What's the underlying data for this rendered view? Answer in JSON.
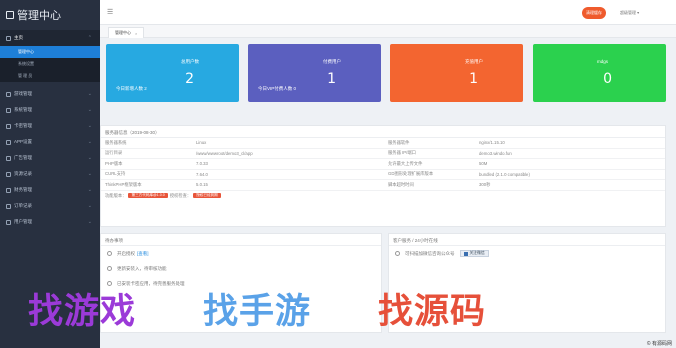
{
  "app": {
    "logo_text": "管理中心"
  },
  "sidebar": {
    "items": [
      {
        "label": "主页",
        "icon": "home-icon",
        "expanded": true
      },
      {
        "label": "游戏管理",
        "icon": "gamepad-icon"
      },
      {
        "label": "系统管理",
        "icon": "settings-icon"
      },
      {
        "label": "卡密管理",
        "icon": "key-icon"
      },
      {
        "label": "APP设置",
        "icon": "app-icon"
      },
      {
        "label": "广告管理",
        "icon": "ad-icon"
      },
      {
        "label": "资源记录",
        "icon": "record-icon"
      },
      {
        "label": "财务管理",
        "icon": "finance-icon"
      },
      {
        "label": "订单记录",
        "icon": "order-icon"
      },
      {
        "label": "用户管理",
        "icon": "user-icon"
      }
    ],
    "subitems": [
      {
        "label": "管理中心",
        "active": true
      },
      {
        "label": "系统设置",
        "active": false
      },
      {
        "label": "管 理 员",
        "active": false
      }
    ]
  },
  "topbar": {
    "menu_icon": "☰",
    "action_button": "清理缓存",
    "user_menu": "超级管理 ▾"
  },
  "tabs": [
    {
      "label": "管理中心"
    }
  ],
  "stats": [
    {
      "label": "总用户数",
      "value": "2",
      "sub": "今日新增人数 2",
      "color": "#27a9e1"
    },
    {
      "label": "付费用户",
      "value": "1",
      "sub": "今日VIP付费人数 0",
      "color": "#5b5fbf"
    },
    {
      "label": "充值用户",
      "value": "1",
      "sub": "",
      "color": "#f36530"
    },
    {
      "label": "mdgs",
      "value": "0",
      "sub": "",
      "color": "#2bd14e"
    }
  ],
  "system_info": {
    "title": "服务器信息（2019-08-30）",
    "rows": [
      {
        "k1": "服务器系统",
        "v1": "Linux",
        "k2": "服务器软件",
        "v2": "nginx/1.15.10"
      },
      {
        "k1": "运行目录",
        "v1": "/www/wwwroot/demo3_cl/app",
        "k2": "服务器 IP/端口",
        "v2": "demo3.windo.fun"
      },
      {
        "k1": "PHP版本",
        "v1": "7.0.33",
        "k2": "允许最大上传文件",
        "v2": "50M"
      },
      {
        "k1": "CURL支持",
        "v1": "7.64.0",
        "k2": "GD图形处理扩展库版本",
        "v2": "bundled (2.1.0 compatible)"
      },
      {
        "k1": "ThinkPHP框架版本",
        "v1": "5.0.15",
        "k2": "脚本超时时间",
        "v2": "300秒"
      }
    ],
    "footer_label": "功能版本：",
    "footer_tag1": "第三方代码库@1.0.0",
    "footer_mid": "授权检查：",
    "footer_tag2": "授权已经到期"
  },
  "todo": {
    "title": "待办事项",
    "items": [
      {
        "text": "开启授权",
        "link": "[查看]"
      },
      {
        "text": "更新安装入，待审核功能",
        "link": ""
      },
      {
        "text": "已安装卡密应用，待完善服务处理",
        "link": ""
      }
    ]
  },
  "weixin": {
    "title": "客户服务 / 24小时在线",
    "items": [
      {
        "text": "可扫描加微信咨询公众号",
        "badge": "关注微信"
      }
    ]
  },
  "watermark": {
    "part1": "找游戏",
    "part2": "找手游",
    "part3": "找源码"
  },
  "corner": "© 有源码网"
}
